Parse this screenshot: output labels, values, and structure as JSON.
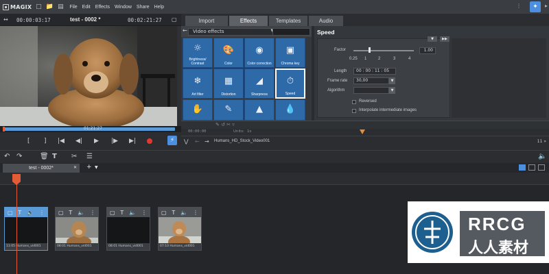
{
  "app": {
    "logo": "MAGIX",
    "menu": [
      "File",
      "Edit",
      "Effects",
      "Window",
      "Share",
      "Help"
    ]
  },
  "preview": {
    "timecode_left": "00:00:03:17",
    "title": "test - 0002 *",
    "timecode_right": "00:02:21:27",
    "progress_label": "01:21:27",
    "progress_fraction": 0.98
  },
  "tabs": [
    {
      "label": "Import",
      "active": false
    },
    {
      "label": "Effects",
      "active": true
    },
    {
      "label": "Templates",
      "active": false
    },
    {
      "label": "Audio",
      "active": false
    }
  ],
  "pool": {
    "dropdown": "Video effects",
    "tiles": [
      {
        "label": "Brightness/ Contrast",
        "icon": "sun-icon"
      },
      {
        "label": "Color",
        "icon": "palette-icon"
      },
      {
        "label": "Color correction",
        "icon": "color-correction-icon"
      },
      {
        "label": "Chroma key",
        "icon": "chroma-key-icon"
      },
      {
        "label": "Art filter",
        "icon": "art-filter-icon"
      },
      {
        "label": "Distortion",
        "icon": "distortion-icon"
      },
      {
        "label": "Sharpness",
        "icon": "sharpness-icon"
      },
      {
        "label": "Speed",
        "icon": "speed-icon",
        "selected": true
      },
      {
        "label": "",
        "icon": "hand-icon"
      },
      {
        "label": "",
        "icon": "brush-icon"
      },
      {
        "label": "",
        "icon": "landscape-icon"
      },
      {
        "label": "",
        "icon": "drop-icon"
      }
    ]
  },
  "speed": {
    "title": "Speed",
    "factor_label": "Factor",
    "factor_value": "1.00",
    "factor_position": 0.25,
    "scale": [
      "0.25",
      "1",
      "2",
      "3",
      "4"
    ],
    "length_label": "Length",
    "length_value": "00 : 00 : 11 : 05",
    "framerate_label": "Frame rate",
    "framerate_value": "30,00",
    "algorithm_label": "Algorithm",
    "algorithm_value": "",
    "reversed_label": "Reversed",
    "interpolate_label": "Interpolate intermediate images"
  },
  "strip": {
    "counter": "00:00:00",
    "units_label": "Units:",
    "units_value": "1s"
  },
  "path": {
    "label": "Humans_HD_Stock_Video001",
    "right": "11 »"
  },
  "timeline": {
    "tab": "test - 0002*"
  },
  "clips": [
    {
      "time": "11:05",
      "name": "Humans_vid001"
    },
    {
      "time": "08:01",
      "name": "Humans_vid001"
    },
    {
      "time": "08:01",
      "name": "Humans_vid001"
    },
    {
      "time": "07:10",
      "name": "Humans_vid001"
    }
  ],
  "watermark": {
    "text1": "RRCG",
    "text2": "人人素材"
  },
  "colors": {
    "accent": "#4c8fe0",
    "tile": "#2f6aa8",
    "playhead": "#e35c38"
  }
}
